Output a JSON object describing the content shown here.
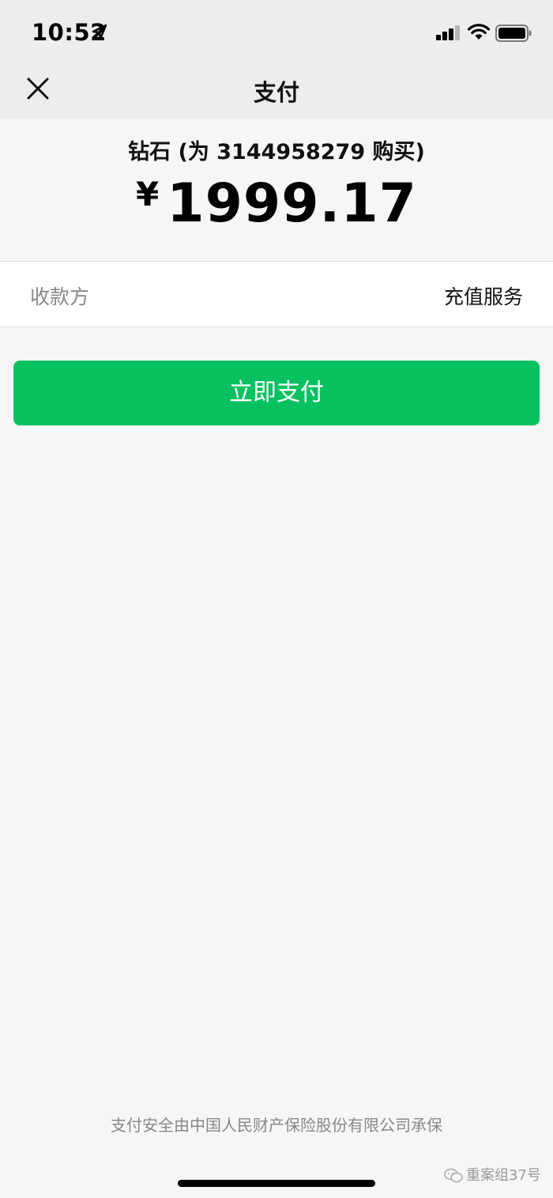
{
  "status_bar": {
    "time": "10:52",
    "icons": [
      "location-arrow-icon",
      "cellular-signal-icon",
      "wifi-icon",
      "battery-icon"
    ]
  },
  "nav": {
    "title": "支付",
    "close_icon": "close-icon"
  },
  "order": {
    "product": "钻石 (为 3144958279 购买)",
    "currency": "¥",
    "amount": "1999.17"
  },
  "payee": {
    "label": "收款方",
    "value": "充值服务"
  },
  "pay_button": {
    "label": "立即支付"
  },
  "footer": {
    "insurance_text": "支付安全由中国人民财产保险股份有限公司承保",
    "watermark": "重案组37号"
  },
  "colors": {
    "accent_green": "#07c160",
    "nav_bg": "#ededed",
    "page_bg": "#f6f6f6"
  }
}
